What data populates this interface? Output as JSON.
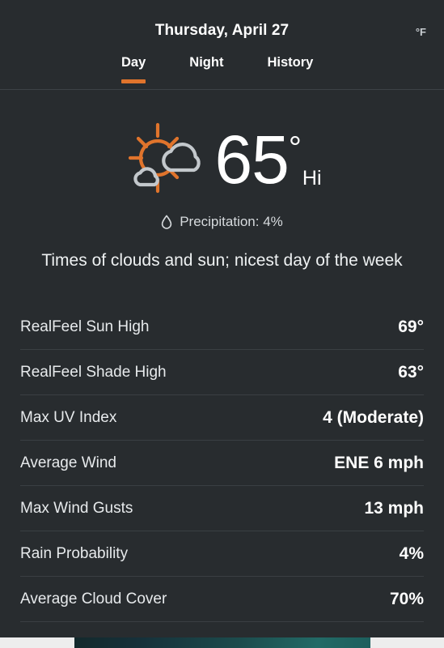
{
  "header": {
    "title": "Thursday, April 27",
    "unit_toggle": "°F",
    "tabs": [
      {
        "label": "Day",
        "active": true
      },
      {
        "label": "Night",
        "active": false
      },
      {
        "label": "History",
        "active": false
      }
    ]
  },
  "hero": {
    "icon": "sun-behind-clouds-icon",
    "temperature": "65",
    "degree_symbol": "°",
    "temp_qualifier": "Hi",
    "precipitation_icon": "water-droplet-icon",
    "precipitation_text": "Precipitation: 4%",
    "phrase": "Times of clouds and sun; nicest day of the week"
  },
  "details": [
    {
      "label": "RealFeel Sun High",
      "value": "69°"
    },
    {
      "label": "RealFeel Shade High",
      "value": "63°"
    },
    {
      "label": "Max UV Index",
      "value": "4 (Moderate)"
    },
    {
      "label": "Average Wind",
      "value": "ENE 6 mph"
    },
    {
      "label": "Max Wind Gusts",
      "value": "13 mph"
    },
    {
      "label": "Rain Probability",
      "value": "4%"
    },
    {
      "label": "Average Cloud Cover",
      "value": "70%"
    }
  ],
  "colors": {
    "background": "#282c2f",
    "accent_orange": "#e0742c",
    "text_primary": "#ffffff",
    "divider": "#3a3f43",
    "page_background": "#ededed",
    "bottom_card_teal": "#226a66"
  }
}
